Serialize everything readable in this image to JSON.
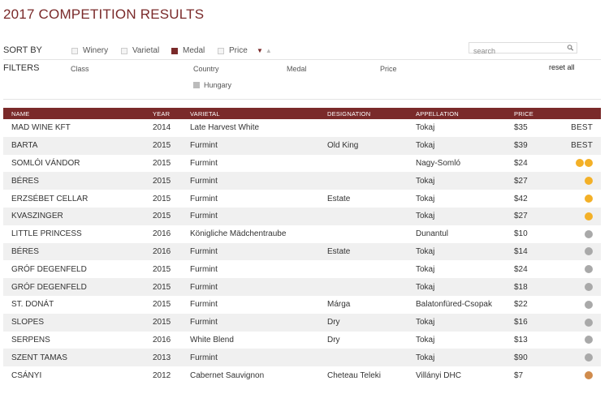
{
  "page_title": "2017 COMPETITION RESULTS",
  "sort": {
    "label": "SORT BY",
    "options": [
      {
        "label": "Winery",
        "checked": false
      },
      {
        "label": "Varietal",
        "checked": false
      },
      {
        "label": "Medal",
        "checked": true
      },
      {
        "label": "Price",
        "checked": false
      }
    ],
    "arrow_down": "▼",
    "arrow_up": "▲"
  },
  "search": {
    "placeholder": "search",
    "value": ""
  },
  "filters": {
    "label": "FILTERS",
    "headings": [
      "Class",
      "Country",
      "Medal",
      "Price"
    ],
    "reset_label": "reset all",
    "country_chip": "Hungary"
  },
  "table": {
    "headers": [
      "NAME",
      "YEAR",
      "VARIETAL",
      "DESIGNATION",
      "APPELLATION",
      "PRICE",
      ""
    ],
    "rows": [
      {
        "name": "MAD WINE KFT",
        "year": "2014",
        "varietal": "Late Harvest White",
        "designation": "",
        "appellation": "Tokaj",
        "price": "$35",
        "medal_text": "BEST",
        "medal_dots": []
      },
      {
        "name": "BARTA",
        "year": "2015",
        "varietal": "Furmint",
        "designation": "Old King",
        "appellation": "Tokaj",
        "price": "$39",
        "medal_text": "BEST",
        "medal_dots": []
      },
      {
        "name": "SOMLÓI VÁNDOR",
        "year": "2015",
        "varietal": "Furmint",
        "designation": "",
        "appellation": "Nagy-Somló",
        "price": "$24",
        "medal_text": "",
        "medal_dots": [
          "#f3b027",
          "#f3b027"
        ]
      },
      {
        "name": "BÉRES",
        "year": "2015",
        "varietal": "Furmint",
        "designation": "",
        "appellation": "Tokaj",
        "price": "$27",
        "medal_text": "",
        "medal_dots": [
          "#f3b027"
        ]
      },
      {
        "name": "ERZSÉBET CELLAR",
        "year": "2015",
        "varietal": "Furmint",
        "designation": "Estate",
        "appellation": "Tokaj",
        "price": "$42",
        "medal_text": "",
        "medal_dots": [
          "#f3b027"
        ]
      },
      {
        "name": "KVASZINGER",
        "year": "2015",
        "varietal": "Furmint",
        "designation": "",
        "appellation": "Tokaj",
        "price": "$27",
        "medal_text": "",
        "medal_dots": [
          "#f3b027"
        ]
      },
      {
        "name": "LITTLE PRINCESS",
        "year": "2016",
        "varietal": "Königliche Mädchentraube",
        "designation": "",
        "appellation": "Dunantul",
        "price": "$10",
        "medal_text": "",
        "medal_dots": [
          "#a9a9a9"
        ]
      },
      {
        "name": "BÉRES",
        "year": "2016",
        "varietal": "Furmint",
        "designation": "Estate",
        "appellation": "Tokaj",
        "price": "$14",
        "medal_text": "",
        "medal_dots": [
          "#a9a9a9"
        ]
      },
      {
        "name": "GRÓF DEGENFELD",
        "year": "2015",
        "varietal": "Furmint",
        "designation": "",
        "appellation": "Tokaj",
        "price": "$24",
        "medal_text": "",
        "medal_dots": [
          "#a9a9a9"
        ]
      },
      {
        "name": "GRÓF DEGENFELD",
        "year": "2015",
        "varietal": "Furmint",
        "designation": "",
        "appellation": "Tokaj",
        "price": "$18",
        "medal_text": "",
        "medal_dots": [
          "#a9a9a9"
        ]
      },
      {
        "name": "ST. DONÁT",
        "year": "2015",
        "varietal": "Furmint",
        "designation": "Márga",
        "appellation": "Balatonfüred-Csopak",
        "price": "$22",
        "medal_text": "",
        "medal_dots": [
          "#a9a9a9"
        ]
      },
      {
        "name": "SLOPES",
        "year": "2015",
        "varietal": "Furmint",
        "designation": "Dry",
        "appellation": "Tokaj",
        "price": "$16",
        "medal_text": "",
        "medal_dots": [
          "#a9a9a9"
        ]
      },
      {
        "name": "SERPENS",
        "year": "2016",
        "varietal": "White Blend",
        "designation": "Dry",
        "appellation": "Tokaj",
        "price": "$13",
        "medal_text": "",
        "medal_dots": [
          "#a9a9a9"
        ]
      },
      {
        "name": "SZENT TAMAS",
        "year": "2013",
        "varietal": "Furmint",
        "designation": "",
        "appellation": "Tokaj",
        "price": "$90",
        "medal_text": "",
        "medal_dots": [
          "#a9a9a9"
        ]
      },
      {
        "name": "CSÁNYI",
        "year": "2012",
        "varietal": "Cabernet Sauvignon",
        "designation": "Cheteau Teleki",
        "appellation": "Villányi DHC",
        "price": "$7",
        "medal_text": "",
        "medal_dots": [
          "#d08b4c"
        ]
      }
    ]
  },
  "colors": {
    "accent": "#7a2a2a",
    "gold": "#f3b027",
    "silver": "#a9a9a9",
    "bronze": "#d08b4c"
  }
}
